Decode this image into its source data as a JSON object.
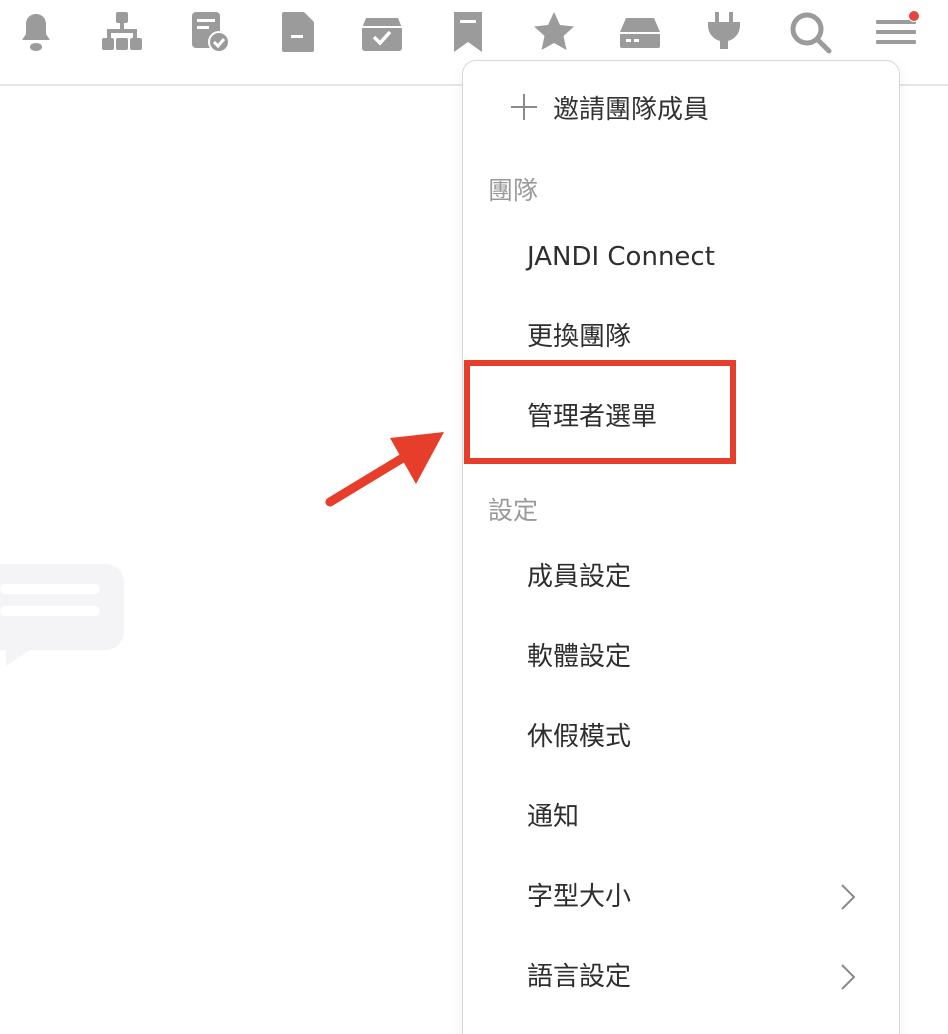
{
  "toolbar": {
    "icons": [
      {
        "name": "notification-bell-icon"
      },
      {
        "name": "org-chart-icon"
      },
      {
        "name": "todo-check-icon"
      },
      {
        "name": "file-icon"
      },
      {
        "name": "archive-box-icon"
      },
      {
        "name": "bookmark-icon"
      },
      {
        "name": "star-icon"
      },
      {
        "name": "drive-icon"
      },
      {
        "name": "plug-icon"
      },
      {
        "name": "search-icon"
      },
      {
        "name": "menu-hamburger-icon"
      }
    ],
    "icon_color": "#9b9b9b",
    "badge_color": "#e3463a"
  },
  "menu": {
    "invite": "邀請團隊成員",
    "team_header": "團隊",
    "team_items": [
      "JANDI Connect",
      "更換團隊",
      "管理者選單"
    ],
    "settings_header": "設定",
    "settings_items": [
      "成員設定",
      "軟體設定",
      "休假模式",
      "通知",
      "字型大小",
      "語言設定"
    ]
  },
  "annotation": {
    "highlighted_item": "管理者選單",
    "color": "#e63e2a"
  }
}
